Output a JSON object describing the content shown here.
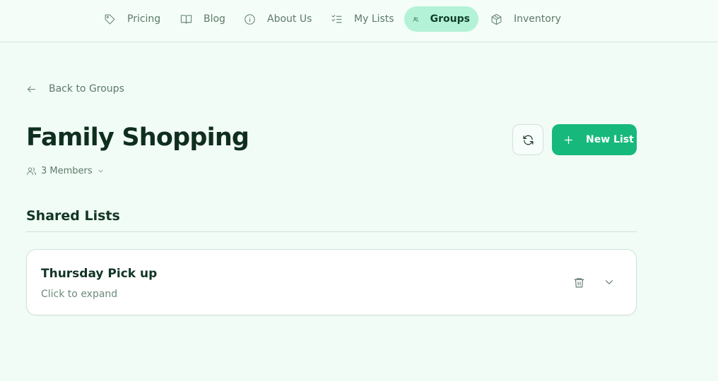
{
  "nav": {
    "items": [
      {
        "label": "Pricing",
        "icon": "tag-icon",
        "active": false
      },
      {
        "label": "Blog",
        "icon": "book-icon",
        "active": false
      },
      {
        "label": "About Us",
        "icon": "info-icon",
        "active": false
      },
      {
        "label": "My Lists",
        "icon": "list-check-icon",
        "active": false
      },
      {
        "label": "Groups",
        "icon": "users-icon",
        "active": true
      },
      {
        "label": "Inventory",
        "icon": "box-icon",
        "active": false
      }
    ]
  },
  "back": {
    "label": "Back to Groups"
  },
  "group": {
    "title": "Family Shopping",
    "members_label": "3 Members"
  },
  "actions": {
    "new_list_label": "New List"
  },
  "section": {
    "title": "Shared Lists"
  },
  "lists": [
    {
      "title": "Thursday Pick up",
      "subtitle": "Click to expand"
    }
  ],
  "colors": {
    "background": "#f1fcf6",
    "accent": "#16b97b",
    "active_nav_bg": "#b3f2d6",
    "text_dark": "#0f2e20",
    "text_muted": "#5d7a6b"
  }
}
